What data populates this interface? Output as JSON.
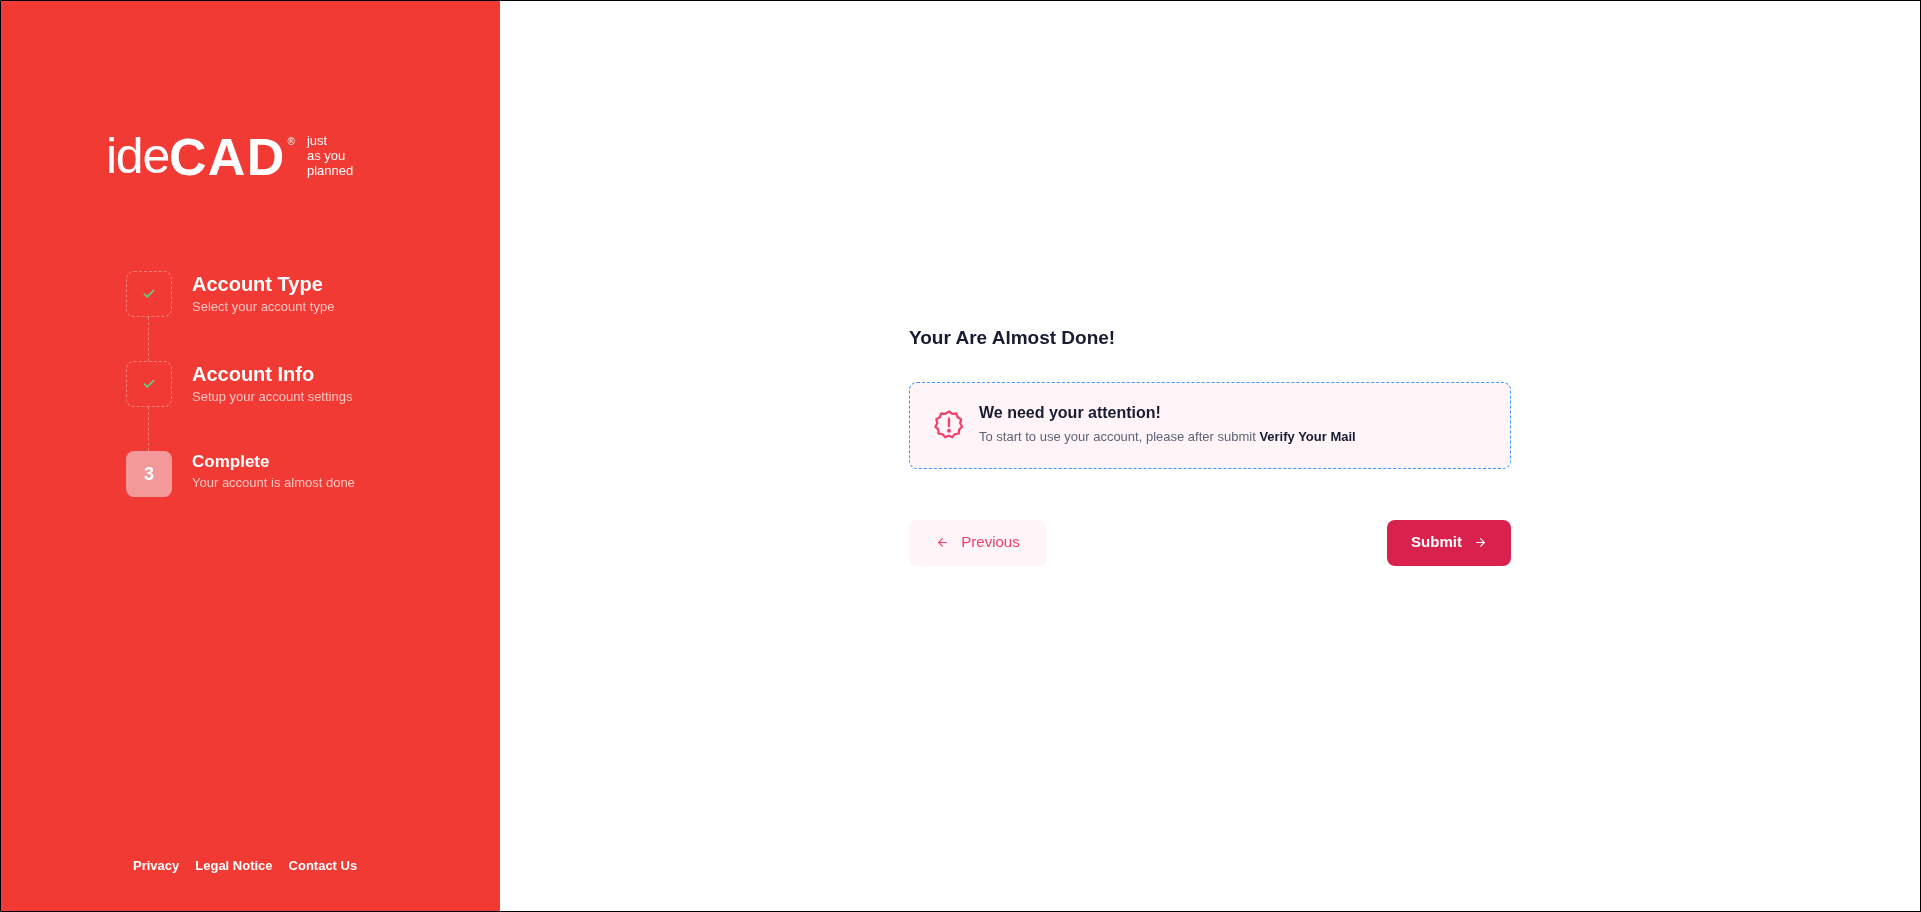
{
  "brand": {
    "light": "ide",
    "bold": "CAD",
    "mark": "®",
    "tagline": [
      "just",
      "as you",
      "planned"
    ]
  },
  "steps": [
    {
      "title": "Account Type",
      "subtitle": "Select your account type",
      "completed": true
    },
    {
      "title": "Account Info",
      "subtitle": "Setup your account settings",
      "completed": true
    },
    {
      "title": "Complete",
      "subtitle": "Your account is almost done",
      "completed": false,
      "number": "3"
    }
  ],
  "footer_links": [
    "Privacy",
    "Legal Notice",
    "Contact Us"
  ],
  "heading": "Your Are Almost Done!",
  "alert": {
    "title": "We need your attention!",
    "text": "To start to use your account, please after submit **Verify Your Mail**"
  },
  "buttons": {
    "previous": "Previous",
    "submit": "Submit"
  }
}
